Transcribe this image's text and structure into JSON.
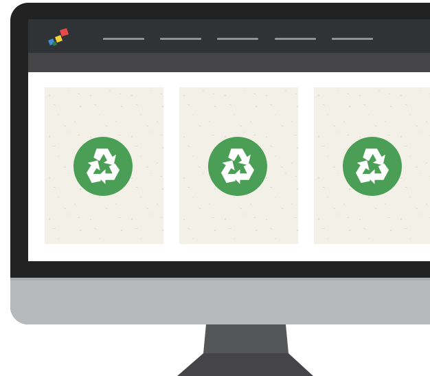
{
  "device": {
    "type": "desktop-monitor",
    "bezel_color": "#222222",
    "chin_color": "#b8b9bb",
    "stand_color": "#555657"
  },
  "website": {
    "logo_icon": "colorful-squares-logo-icon",
    "logo_colors": [
      "#e84a4a",
      "#f5d43a",
      "#3a8fd9"
    ],
    "navbar_color": "#303335",
    "subbar_color": "#454547",
    "nav_link_count": 5,
    "nav_link_color": "#8e9495",
    "cards": [
      {
        "icon": "recycle-icon",
        "badge_color": "#4a9e55",
        "background": "#f3f1e7"
      },
      {
        "icon": "recycle-icon",
        "badge_color": "#4a9e55",
        "background": "#f3f1e7"
      },
      {
        "icon": "recycle-icon",
        "badge_color": "#4a9e55",
        "background": "#f3f1e7"
      }
    ]
  }
}
